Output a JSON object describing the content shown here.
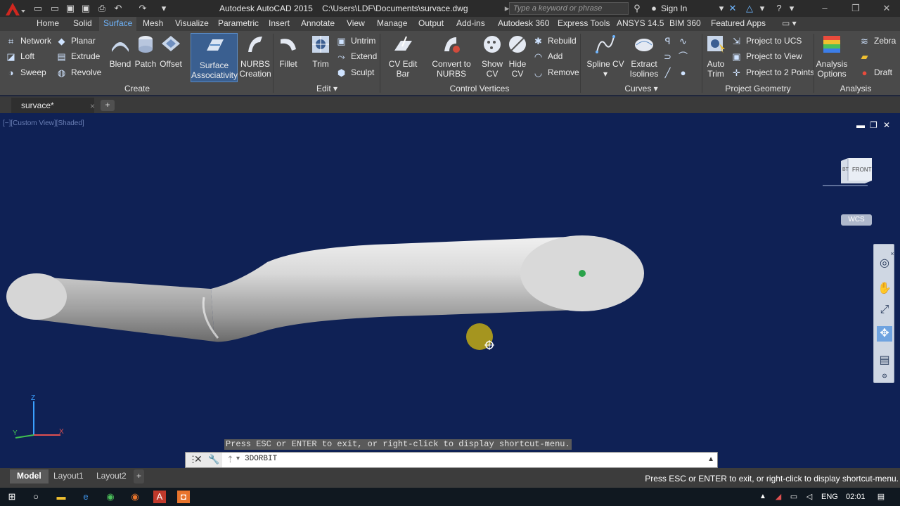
{
  "window": {
    "app_title": "Autodesk AutoCAD 2015    C:\\Users\\LDF\\Documents\\survace.dwg",
    "search_placeholder": "Type a keyword or phrase",
    "signin_label": "Sign In",
    "logo_letter": "A"
  },
  "tabs": [
    {
      "label": "Home"
    },
    {
      "label": "Solid"
    },
    {
      "label": "Surface",
      "active": true
    },
    {
      "label": "Mesh"
    },
    {
      "label": "Visualize"
    },
    {
      "label": "Parametric"
    },
    {
      "label": "Insert"
    },
    {
      "label": "Annotate"
    },
    {
      "label": "View"
    },
    {
      "label": "Manage"
    },
    {
      "label": "Output"
    },
    {
      "label": "Add-ins"
    },
    {
      "label": "Autodesk 360"
    },
    {
      "label": "Express Tools"
    },
    {
      "label": "ANSYS 14.5"
    },
    {
      "label": "BIM 360"
    },
    {
      "label": "Featured Apps"
    }
  ],
  "ribbon": {
    "create": {
      "title": "Create",
      "network": "Network",
      "loft": "Loft",
      "sweep": "Sweep",
      "planar": "Planar",
      "extrude": "Extrude",
      "revolve": "Revolve",
      "blend": "Blend",
      "patch": "Patch",
      "offset": "Offset",
      "surface_assoc_1": "Surface",
      "surface_assoc_2": "Associativity",
      "nurbs_1": "NURBS",
      "nurbs_2": "Creation"
    },
    "edit": {
      "title": "Edit",
      "fillet": "Fillet",
      "trim": "Trim",
      "untrim": "Untrim",
      "extend": "Extend",
      "sculpt": "Sculpt"
    },
    "control_vertices": {
      "title": "Control Vertices",
      "cv_edit_bar": "CV Edit Bar",
      "convert_1": "Convert to",
      "convert_2": "NURBS",
      "show_1": "Show",
      "show_2": "CV",
      "hide_1": "Hide",
      "hide_2": "CV",
      "rebuild": "Rebuild",
      "add": "Add",
      "remove": "Remove"
    },
    "curves": {
      "title": "Curves",
      "spline_cv": "Spline CV",
      "extract_1": "Extract",
      "extract_2": "Isolines"
    },
    "project_geometry": {
      "title": "Project Geometry",
      "auto_1": "Auto",
      "auto_2": "Trim",
      "project_ucs": "Project to UCS",
      "project_view": "Project to View",
      "project_2pts": "Project to 2 Points"
    },
    "analysis": {
      "title": "Analysis",
      "options_1": "Analysis",
      "options_2": "Options",
      "zebra": "Zebra",
      "draft": "Draft"
    }
  },
  "file_tab": {
    "label": "survace*",
    "close": "×",
    "new": "+"
  },
  "viewport": {
    "label": "[−][Custom View][Shaded]",
    "viewcube_top": "BT",
    "viewcube_face": "FRONT",
    "wcs_label": "WCS",
    "min": "▬",
    "restore": "❐",
    "close": "✕"
  },
  "command": {
    "hint": "Press ESC or ENTER to exit, or right-click to display shortcut-menu.",
    "input": "3DORBIT"
  },
  "layout_tabs": [
    {
      "label": "Model",
      "active": true
    },
    {
      "label": "Layout1"
    },
    {
      "label": "Layout2"
    }
  ],
  "status_message": "Press ESC or ENTER to exit, or right-click to display shortcut-menu.",
  "taskbar": {
    "language": "ENG",
    "time": "02:01"
  },
  "colors": {
    "viewport_bg": "#0f2155",
    "active_tab": "#6fb6ff",
    "app_red": "#d0271f"
  }
}
